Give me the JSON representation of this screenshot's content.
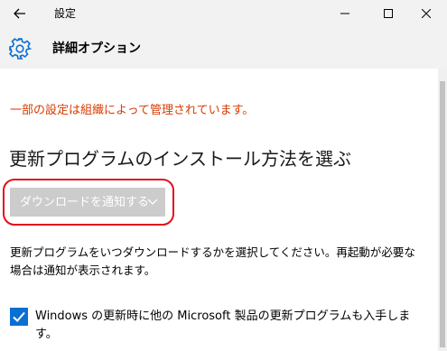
{
  "window": {
    "title": "設定",
    "back_icon": "arrow-left-icon",
    "minimize_icon": "minimize-icon",
    "maximize_icon": "maximize-icon",
    "close_icon": "close-icon"
  },
  "header": {
    "icon": "gear-icon",
    "title": "詳細オプション"
  },
  "main": {
    "org_notice": "一部の設定は組織によって管理されています。",
    "section_title": "更新プログラムのインストール方法を選ぶ",
    "dropdown": {
      "selected": "ダウンロードを通知する",
      "disabled": true
    },
    "description": "更新プログラムをいつダウンロードするかを選択してください。再起動が必要な場合は通知が表示されます。",
    "checkbox": {
      "checked": true,
      "label": "Windows の更新時に他の Microsoft 製品の更新プログラムも入手します。"
    }
  },
  "colors": {
    "accent": "#0a6fd2",
    "warning": "#d83b01",
    "highlight": "#e0101e",
    "disabled_fill": "#cccccc"
  }
}
